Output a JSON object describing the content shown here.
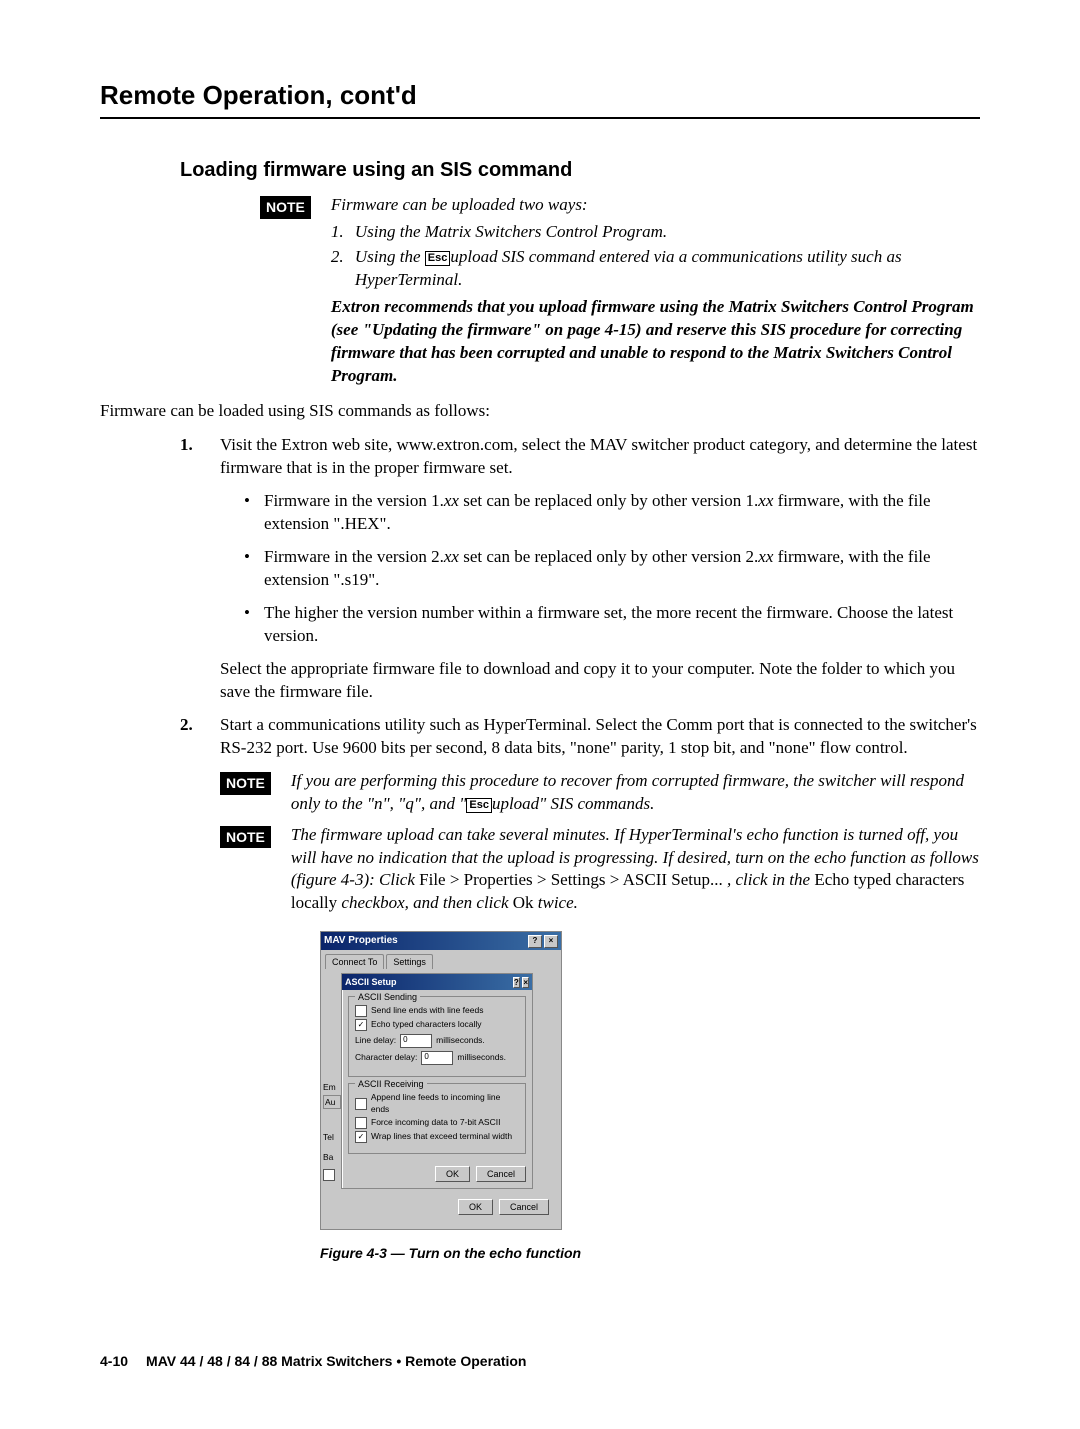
{
  "header": {
    "title": "Remote Operation, cont'd"
  },
  "section": {
    "heading": "Loading firmware using an SIS command"
  },
  "noteLabel": "NOTE",
  "escLabel": "Esc",
  "note1": {
    "intro": "Firmware can be uploaded two ways:",
    "items": [
      {
        "num": "1.",
        "text": "Using the Matrix Switchers Control Program."
      },
      {
        "num": "2.",
        "pre": "Using the ",
        "post": "upload SIS command entered via a communications utility such as HyperTerminal."
      }
    ],
    "rec": "Extron recommends that you upload firmware using the Matrix Switchers Control Program (see \"Updating the firmware\" on page 4-15) and reserve this SIS procedure for correcting firmware that has been corrupted and unable to respond to the Matrix Switchers Control Program."
  },
  "lead": "Firmware can be loaded using SIS commands as follows:",
  "steps": [
    {
      "num": "1.",
      "text": "Visit the Extron web site, www.extron.com, select the MAV switcher product category, and determine the latest firmware that is in the proper firmware set.",
      "bullets": [
        {
          "pre": "Firmware in the version 1.",
          "xx1": "xx",
          "mid1": " set can be replaced only by other version 1.",
          "xx2": "xx",
          "post": " firmware, with the file extension \".HEX\"."
        },
        {
          "pre": "Firmware in the version 2.",
          "xx1": "xx",
          "mid1": " set can be replaced only by other version 2.",
          "xx2": "xx",
          "post": " firmware, with the file extension \".s19\"."
        },
        {
          "plain": "The higher the version number within a firmware set, the more recent the firmware.  Choose the latest version."
        }
      ],
      "tail": "Select the appropriate firmware file to download and copy it to your computer.  Note the folder to which you save the firmware file."
    },
    {
      "num": "2.",
      "text": "Start a communications utility such as HyperTerminal.  Select the Comm port that is connected to the switcher's RS-232 port.  Use 9600 bits per second, 8 data bits, \"none\" parity, 1 stop bit, and \"none\" flow control."
    }
  ],
  "note2": {
    "pre": "If you are performing this procedure to recover from corrupted firmware, the switcher will respond only to the \"n\", \"q\", and \"",
    "post": "upload\" SIS commands."
  },
  "note3": {
    "line1": "The firmware upload can take several minutes.  If HyperTerminal's echo function is turned off, you will have no indication that the upload is progressing.  If desired, turn on the echo function as follows (figure 4-3):  Click ",
    "path": "File > Properties > Settings > ASCII Setup...",
    "mid": " , click in the ",
    "opt": "Echo typed characters locally",
    "mid2": " checkbox, and then click ",
    "ok": "Ok",
    "end": " twice."
  },
  "dialog": {
    "title": "MAV Properties",
    "help": "?",
    "close": "×",
    "tabs": [
      "Connect To",
      "Settings"
    ],
    "inner": {
      "title": "ASCII Setup",
      "sending": {
        "legend": "ASCII Sending",
        "chk1": "Send line ends with line feeds",
        "chk2": "Echo typed characters locally",
        "lineDelayLabel": "Line delay:",
        "lineDelayVal": "0",
        "ms": "milliseconds.",
        "charDelayLabel": "Character delay:",
        "charDelayVal": "0",
        "ms2": "milliseconds."
      },
      "receiving": {
        "legend": "ASCII Receiving",
        "chk1": "Append line feeds to incoming line ends",
        "chk2": "Force incoming data to 7-bit ASCII",
        "chk3": "Wrap lines that exceed terminal width"
      },
      "ok": "OK",
      "cancel": "Cancel"
    },
    "side": {
      "em": "Em",
      "au": "Au",
      "tel": "Tel",
      "ba": "Ba",
      "chk": ""
    },
    "ok": "OK",
    "cancel": "Cancel"
  },
  "figure": {
    "caption": "Figure 4-3 — Turn on the echo function"
  },
  "footer": {
    "page": "4-10",
    "text": "MAV 44 / 48 / 84 / 88 Matrix Switchers • Remote Operation"
  }
}
